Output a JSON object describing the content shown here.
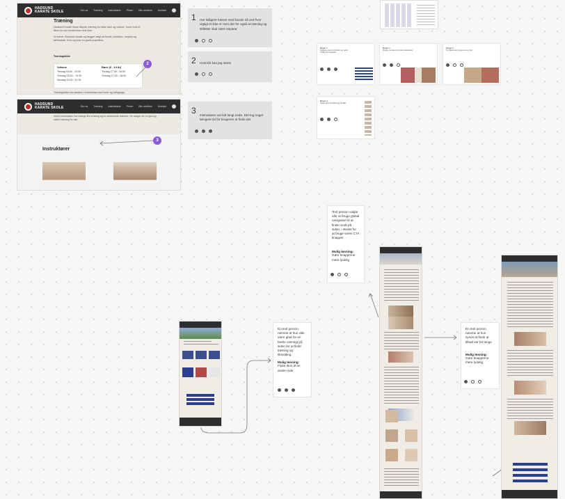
{
  "site": {
    "brand_line1": "HADSUND",
    "brand_line2": "KARATE SKOLE",
    "nav": [
      "Om os",
      "Træning",
      "Instruktører",
      "Priser",
      "Bliv medlem",
      "Kontakt"
    ]
  },
  "frame1": {
    "title": "Træning",
    "para1": "Hadsund Karate Skole tilbyder træning for både børn og voksne. Vores hold er åbne for nye medlemmer hele året.",
    "para2": "Vi træner Shotokan karate og lægger vægt på teknik, kondition, respekt og fællesskab. Kom og prøv en gratis prøvetime.",
    "schedule_heading": "Træningstider",
    "col1_title": "Voksne",
    "col1_rows": [
      "Tirsdag  18:00 - 19:30",
      "Torsdag  18:00 - 19:30",
      "Søndag   10:00 - 11:30"
    ],
    "col2_title": "Børn (6 - 14 år)",
    "col2_rows": [
      "Tirsdag  17:00 - 18:00",
      "Torsdag  17:00 - 18:00"
    ],
    "footnote": "Træningstider kan ændres i forbindelse med ferier og helligdage."
  },
  "frame2": {
    "intro": "Vores instruktører har mange års erfaring og er uddannede trænere. De sørger for en god og sikker træning for alle.",
    "title": "Instruktører"
  },
  "badges": [
    "2",
    "3"
  ],
  "notes": [
    {
      "num": "1",
      "text": "Har tidligere trænet med karate så ved hvor vigtigt et ikke er men der for også at træning og stilletter skal være separat"
    },
    {
      "num": "2",
      "text": "Hvornår kan jeg starte"
    },
    {
      "num": "3",
      "text": "Instruktører var lidt langt nede. Det tog noget længere tid for brugeren at finde det"
    }
  ],
  "sticky_left": {
    "text": "En test person nævnte at hun ville være glad for en bedre oversigt på siden for at finde træning og tilmelding",
    "heading": "Mulig løsning:",
    "solution": "Flytte dem til en anden side"
  },
  "sticky_top": {
    "text": "Test person valgte ofte at bruge global navigation til at finde rundt på siden, i stedet for at bruge vores CTA knapper",
    "heading": "Mulig løsning:",
    "solution": "Gøre knapperne mere tydelig"
  },
  "sticky_right": {
    "text": "En test person nævnte at hun synes at finde at tilbud var for lange",
    "heading": "Mulig løsning:",
    "solution": "Gøre knapperne mere tydelig"
  },
  "mini_cards": [
    {
      "head": "Bruger 1",
      "body": "Kiggede mest på forsiden og fandt hurtigt træningstider"
    },
    {
      "head": "Bruger 2",
      "body": "Brugte menuen til at finde instruktører"
    },
    {
      "head": "Bruger 3",
      "body": "Scrollede ned og læste om priser"
    },
    {
      "head": "Bruger 4",
      "body": "Søgte efter tilmelding og kontakt"
    }
  ],
  "colors": {
    "accent": "#8c5bd8",
    "nav": "#2e2e2e",
    "brand_red": "#c62828",
    "button_blue": "#2c3e8f"
  }
}
